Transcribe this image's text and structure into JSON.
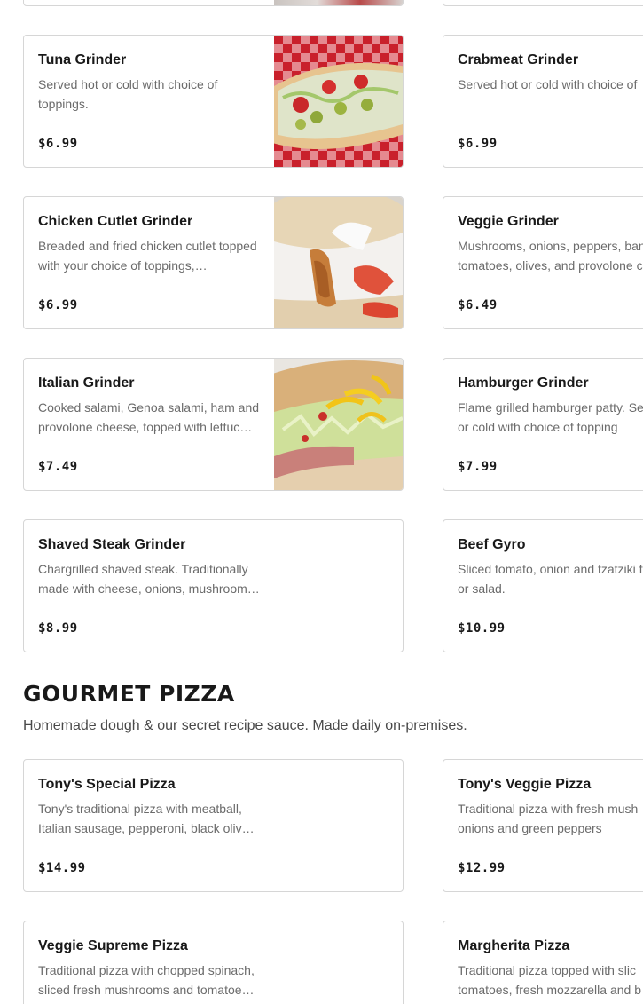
{
  "grinders": {
    "left": [
      {
        "name": "Tuna Grinder",
        "description": "Served hot or cold with choice of toppings.",
        "price": "$6.99"
      },
      {
        "name": "Chicken Cutlet Grinder",
        "description": "Breaded and fried chicken cutlet topped with your choice of toppings,…",
        "price": "$6.99"
      },
      {
        "name": "Italian Grinder",
        "description": "Cooked salami, Genoa salami, ham and provolone cheese, topped with lettuc…",
        "price": "$7.49"
      },
      {
        "name": "Shaved Steak Grinder",
        "description": "Chargrilled shaved steak. Traditionally made with cheese, onions, mushroom…",
        "price": "$8.99"
      }
    ],
    "right": [
      {
        "name": "Crabmeat Grinder",
        "description": "Served hot or cold with choice of",
        "price": "$6.99"
      },
      {
        "name": "Veggie Grinder",
        "description": "Mushrooms, onions, peppers, ban tomatoes, olives, and provolone c",
        "price": "$6.49"
      },
      {
        "name": "Hamburger Grinder",
        "description": "Flame grilled hamburger patty. Se hot or cold with choice of topping",
        "price": "$7.99"
      },
      {
        "name": "Beef Gyro",
        "description": "Sliced tomato, onion and tzatziki fries or salad.",
        "price": "$10.99"
      }
    ]
  },
  "section": {
    "title": "GOURMET PIZZA",
    "subtitle": "Homemade dough & our secret recipe sauce. Made daily on-premises."
  },
  "pizzas": {
    "left": [
      {
        "name": "Tony's Special Pizza",
        "description": "Tony's traditional pizza with meatball, Italian sausage, pepperoni, black oliv…",
        "price": "$14.99"
      },
      {
        "name": "Veggie Supreme Pizza",
        "description": "Traditional pizza with chopped spinach, sliced fresh mushrooms and tomatoe…",
        "price": ""
      }
    ],
    "right": [
      {
        "name": "Tony's Veggie Pizza",
        "description": "Traditional pizza with fresh mush onions and green peppers",
        "price": "$12.99"
      },
      {
        "name": "Margherita Pizza",
        "description": "Traditional pizza topped with slic tomatoes, fresh mozzarella and b",
        "price": ""
      }
    ]
  },
  "images": {
    "tuna": "tuna-grinder-photo",
    "chicken": "chicken-cutlet-grinder-photo",
    "italian": "italian-grinder-photo"
  }
}
